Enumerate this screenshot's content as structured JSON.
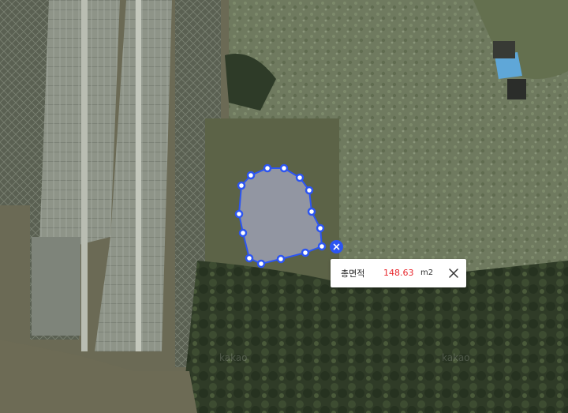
{
  "map": {
    "layer": "satellite",
    "polygon_color": "#2c55f2",
    "polygon_fill": "#9aa0c8",
    "vertex_count": 15
  },
  "area_popup": {
    "label": "총면적",
    "value": "148.63",
    "unit": "m2",
    "value_color": "#e8262c",
    "close_icon": "close-icon"
  },
  "delete_control": {
    "icon": "x-icon"
  },
  "watermark": {
    "text": "kakao"
  }
}
